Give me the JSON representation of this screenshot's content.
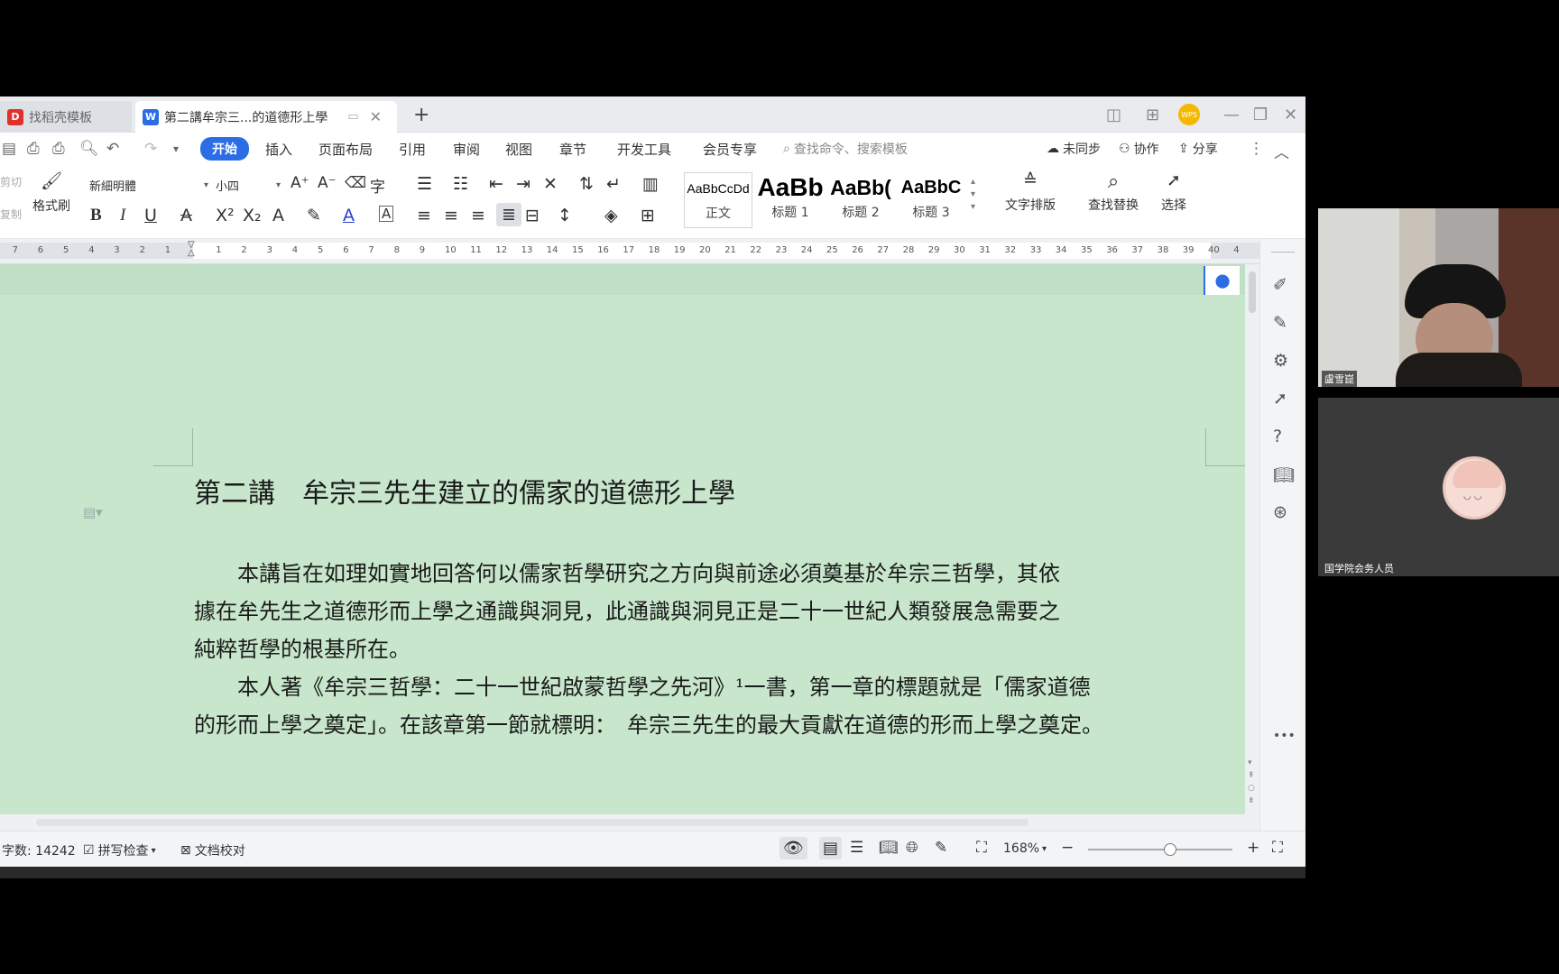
{
  "tabs": {
    "tab1": "找稻壳模板",
    "tab2": "第二講牟宗三...的道德形上學",
    "new_tab": "+",
    "avatar_text": "WPS"
  },
  "menu": {
    "start": "开始",
    "insert": "插入",
    "layout": "页面布局",
    "reference": "引用",
    "review": "审阅",
    "view": "视图",
    "chapter": "章节",
    "devtools": "开发工具",
    "member": "会员专享",
    "search_placeholder": "查找命令、搜索模板",
    "sync": "未同步",
    "collab": "协作",
    "share": "分享"
  },
  "ribbon": {
    "cut": "剪切",
    "copy": "复制",
    "format_painter": "格式刷",
    "font_name": "新細明體",
    "font_size": "小四",
    "styles": [
      {
        "sample": "AaBbCcDd",
        "name": "正文"
      },
      {
        "sample": "AaBb",
        "name": "标题 1"
      },
      {
        "sample": "AaBb(",
        "name": "标题 2"
      },
      {
        "sample": "AaBbC",
        "name": "标题 3"
      }
    ],
    "text_layout": "文字排版",
    "find_replace": "查找替换",
    "select": "选择"
  },
  "ruler": {
    "left_nums": [
      "7",
      "6",
      "5",
      "4",
      "3",
      "2",
      "1"
    ],
    "right_nums": [
      "1",
      "2",
      "3",
      "4",
      "5",
      "6",
      "7",
      "8",
      "9",
      "10",
      "11",
      "12",
      "13",
      "14",
      "15",
      "16",
      "17",
      "18",
      "19",
      "20",
      "21",
      "22",
      "23",
      "24",
      "25",
      "26",
      "27",
      "28",
      "29",
      "30",
      "31",
      "32",
      "33",
      "34",
      "35",
      "36",
      "37",
      "38",
      "39",
      "40",
      "4"
    ]
  },
  "document": {
    "heading": "第二講　牟宗三先生建立的儒家的道德形上學",
    "lines": [
      "　　本講旨在如理如實地回答何以儒家哲學研究之方向與前途必須奠基於牟宗三哲學，其依",
      "據在牟先生之道德形而上學之通識與洞見，此通識與洞見正是二十一世紀人類發展急需要之",
      "純粹哲學的根基所在。",
      "　　本人著《牟宗三哲學：二十一世紀啟蒙哲學之先河》¹一書，第一章的標題就是「儒家道德",
      "的形而上學之奠定」。在該章第一節就標明：　牟宗三先生的最大貢獻在道德的形而上學之奠定。"
    ]
  },
  "status": {
    "word_count": "字数: 14242",
    "spell_check": "拼写检查",
    "doc_proof": "文档校对",
    "zoom": "168%"
  },
  "video": {
    "participant1": "盧雪崑",
    "participant2": "国学院会务人员"
  }
}
